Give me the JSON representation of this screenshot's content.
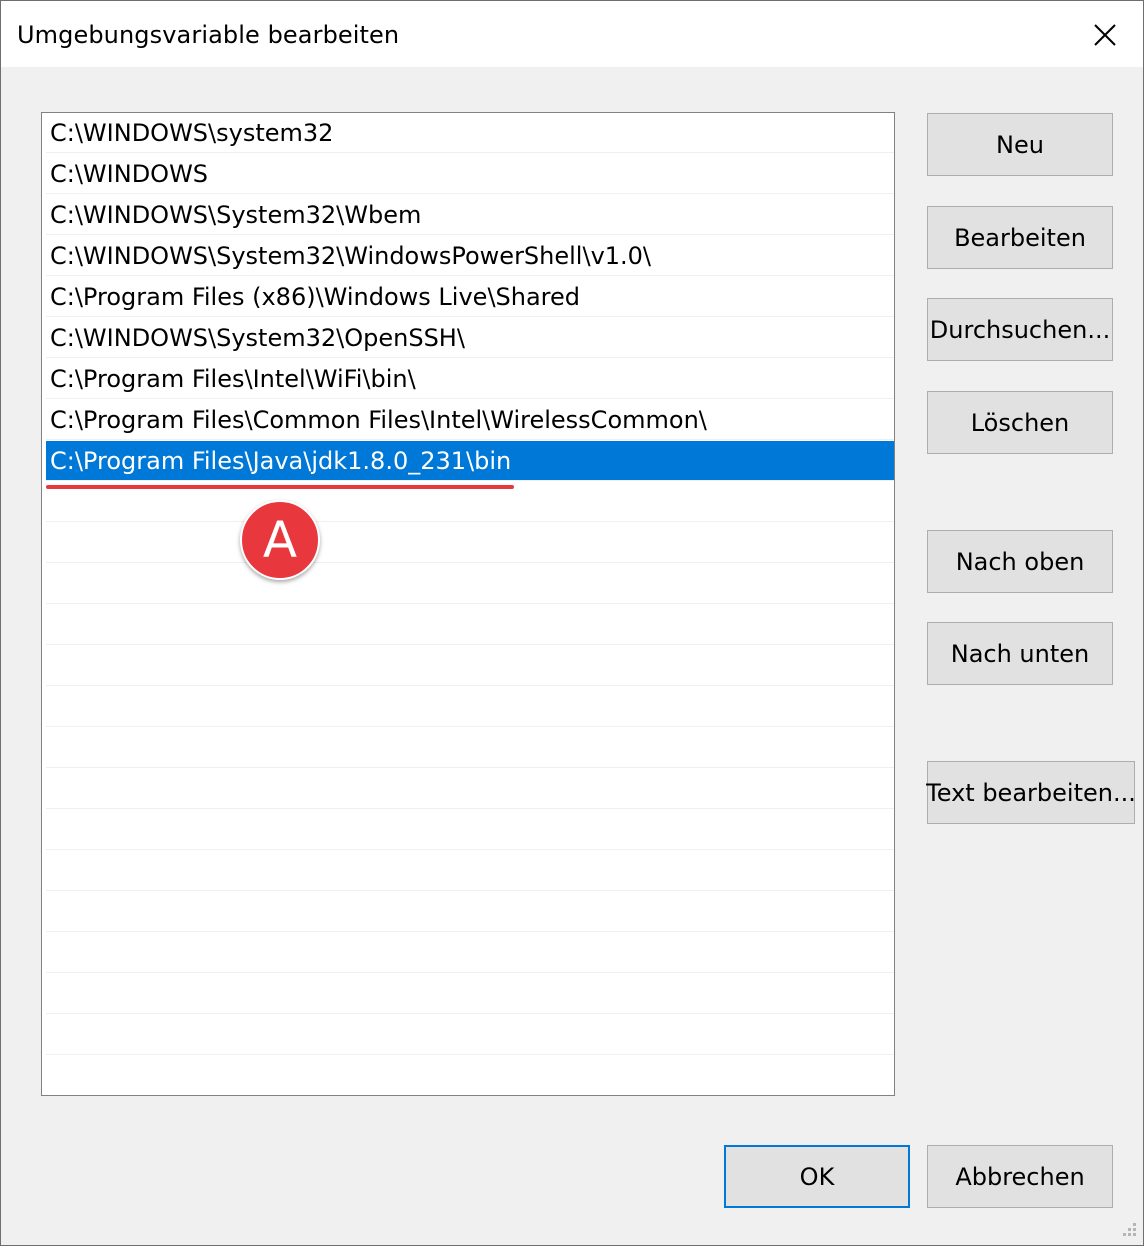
{
  "window": {
    "title": "Umgebungsvariable bearbeiten"
  },
  "path_list": {
    "entries": [
      "C:\\WINDOWS\\system32",
      "C:\\WINDOWS",
      "C:\\WINDOWS\\System32\\Wbem",
      "C:\\WINDOWS\\System32\\WindowsPowerShell\\v1.0\\",
      "C:\\Program Files (x86)\\Windows Live\\Shared",
      "C:\\WINDOWS\\System32\\OpenSSH\\",
      "C:\\Program Files\\Intel\\WiFi\\bin\\",
      "C:\\Program Files\\Common Files\\Intel\\WirelessCommon\\",
      "C:\\Program Files\\Java\\jdk1.8.0_231\\bin"
    ],
    "selected_index": 8
  },
  "buttons": {
    "new": "Neu",
    "edit": "Bearbeiten",
    "browse": "Durchsuchen...",
    "delete": "Löschen",
    "move_up": "Nach oben",
    "move_down": "Nach unten",
    "edit_text": "Text bearbeiten...",
    "ok": "OK",
    "cancel": "Abbrechen"
  },
  "annotation": {
    "badge_label": "A",
    "color": "#e8383d"
  },
  "colors": {
    "selection": "#0078d7",
    "button_face": "#e1e1e1",
    "dialog_bg": "#f0f0f0"
  },
  "icons": {
    "close": "close-icon",
    "resize": "resize-grip-icon"
  }
}
